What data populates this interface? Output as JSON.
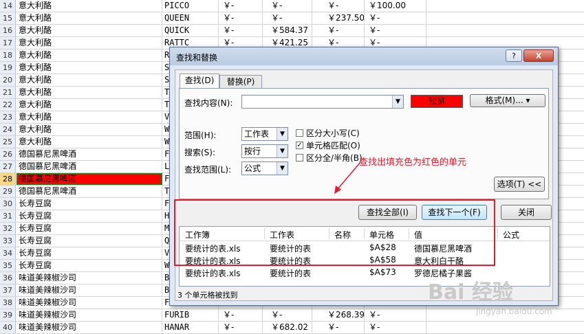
{
  "sheet": {
    "rows": [
      {
        "num": "14",
        "a": "意大利酪",
        "b": "PICCO",
        "c": "￥-",
        "d": "￥-",
        "e": "￥-",
        "f": "￥100.00"
      },
      {
        "num": "15",
        "a": "意大利酪",
        "b": "QUEEN",
        "c": "￥-",
        "d": "￥-",
        "e": "￥237.50",
        "f": "￥-"
      },
      {
        "num": "16",
        "a": "意大利酪",
        "b": "QUICK",
        "c": "￥-",
        "d": "￥584.37",
        "e": "￥-",
        "f": "￥-"
      },
      {
        "num": "17",
        "a": "意大利酪",
        "b": "RATTC",
        "c": "￥-",
        "d": "￥421.25",
        "e": "￥-",
        "f": "￥-"
      },
      {
        "num": "18",
        "a": "意大利酪",
        "b": "R",
        "c": "",
        "d": "",
        "e": "",
        "f": ""
      },
      {
        "num": "19",
        "a": "意大利酪",
        "b": "S",
        "c": "",
        "d": "",
        "e": "",
        "f": ""
      },
      {
        "num": "20",
        "a": "意大利酪",
        "b": "S",
        "c": "",
        "d": "",
        "e": "",
        "f": ""
      },
      {
        "num": "21",
        "a": "意大利酪",
        "b": "T",
        "c": "",
        "d": "",
        "e": "",
        "f": ""
      },
      {
        "num": "22",
        "a": "意大利酪",
        "b": "T",
        "c": "",
        "d": "",
        "e": "",
        "f": ""
      },
      {
        "num": "23",
        "a": "意大利酪",
        "b": "V",
        "c": "",
        "d": "",
        "e": "",
        "f": ""
      },
      {
        "num": "24",
        "a": "意大利酪",
        "b": "W",
        "c": "",
        "d": "",
        "e": "",
        "f": ""
      },
      {
        "num": "25",
        "a": "意大利酪",
        "b": "W",
        "c": "",
        "d": "",
        "e": "",
        "f": ""
      },
      {
        "num": "26",
        "a": "德国慕尼黑啤酒",
        "b": "F",
        "c": "",
        "d": "",
        "e": "",
        "f": ""
      },
      {
        "num": "27",
        "a": "德国慕尼黑啤酒",
        "b": "L",
        "c": "",
        "d": "",
        "e": "",
        "f": ""
      },
      {
        "num": "28",
        "a": "德国慕尼黑啤酒",
        "b": "F",
        "c": "",
        "d": "",
        "e": "",
        "f": ""
      },
      {
        "num": "29",
        "a": "德国慕尼黑啤酒",
        "b": "T",
        "c": "",
        "d": "",
        "e": "",
        "f": ""
      },
      {
        "num": "30",
        "a": "长寿豆腐",
        "b": "F",
        "c": "",
        "d": "",
        "e": "",
        "f": ""
      },
      {
        "num": "31",
        "a": "长寿豆腐",
        "b": "H",
        "c": "",
        "d": "",
        "e": "",
        "f": ""
      },
      {
        "num": "32",
        "a": "长寿豆腐",
        "b": "M",
        "c": "",
        "d": "",
        "e": "",
        "f": ""
      },
      {
        "num": "33",
        "a": "长寿豆腐",
        "b": "Q",
        "c": "",
        "d": "",
        "e": "",
        "f": ""
      },
      {
        "num": "34",
        "a": "长寿豆腐",
        "b": "V",
        "c": "",
        "d": "",
        "e": "",
        "f": ""
      },
      {
        "num": "35",
        "a": "长寿豆腐",
        "b": "W",
        "c": "",
        "d": "",
        "e": "",
        "f": ""
      },
      {
        "num": "36",
        "a": "味道美辣椒沙司",
        "b": "B",
        "c": "",
        "d": "",
        "e": "",
        "f": ""
      },
      {
        "num": "37",
        "a": "味道美辣椒沙司",
        "b": "B",
        "c": "",
        "d": "",
        "e": "",
        "f": ""
      },
      {
        "num": "38",
        "a": "味道美辣椒沙司",
        "b": "F",
        "c": "",
        "d": "",
        "e": "",
        "f": ""
      },
      {
        "num": "39",
        "a": "味道美辣椒沙司",
        "b": "FURIB",
        "c": "￥-",
        "d": "￥-",
        "e": "￥268.39",
        "f": "￥-"
      },
      {
        "num": "40",
        "a": "味道美辣椒沙司",
        "b": "HANAR",
        "c": "￥-",
        "d": "￥682.02",
        "e": "￥-",
        "f": "￥-"
      }
    ]
  },
  "dialog": {
    "title": "查找和替换",
    "help": "?",
    "close": "X",
    "tabs": [
      "查找(D)",
      "替换(P)"
    ],
    "find_label": "查找内容(N):",
    "find_value": "",
    "preview_label": "预览",
    "format_label": "格式(M)... ▾",
    "scope_label": "范围(H):",
    "scope_value": "工作表",
    "search_label": "搜索(S):",
    "search_value": "按行",
    "lookin_label": "查找范围(L):",
    "lookin_value": "公式",
    "match_case_label": "区分大小写(C)",
    "match_case_checked": false,
    "match_cell_label": "单元格匹配(O)",
    "match_cell_checked": true,
    "match_width_label": "区分全/半角(B)",
    "match_width_checked": false,
    "options_label": "选项(T) <<",
    "find_all_label": "查找全部(I)",
    "find_next_label": "查找下一个(F)",
    "close_label": "关闭",
    "results_headers": [
      "工作簿",
      "工作表",
      "名称",
      "单元格",
      "值",
      "公式"
    ],
    "results": [
      {
        "workbook": "要统计的表.xls",
        "sheet": "要统计的表",
        "name": "",
        "cell": "$A$28",
        "value": "德国慕尼黑啤酒",
        "formula": ""
      },
      {
        "workbook": "要统计的表.xls",
        "sheet": "要统计的表",
        "name": "",
        "cell": "$A$58",
        "value": "意大利白干酪",
        "formula": ""
      },
      {
        "workbook": "要统计的表.xls",
        "sheet": "要统计的表",
        "name": "",
        "cell": "$A$73",
        "value": "罗德尼橘子果酱",
        "formula": ""
      }
    ],
    "status": "3 个单元格被找到"
  },
  "annotation": "查找出填充色为红色的单元",
  "watermark": {
    "brand": "Bai 经验",
    "url": "jingyan.baidu.com"
  },
  "colors": {
    "highlight": "#ff0000",
    "annotation": "#e8192c",
    "selection": "#1a7d1a"
  }
}
